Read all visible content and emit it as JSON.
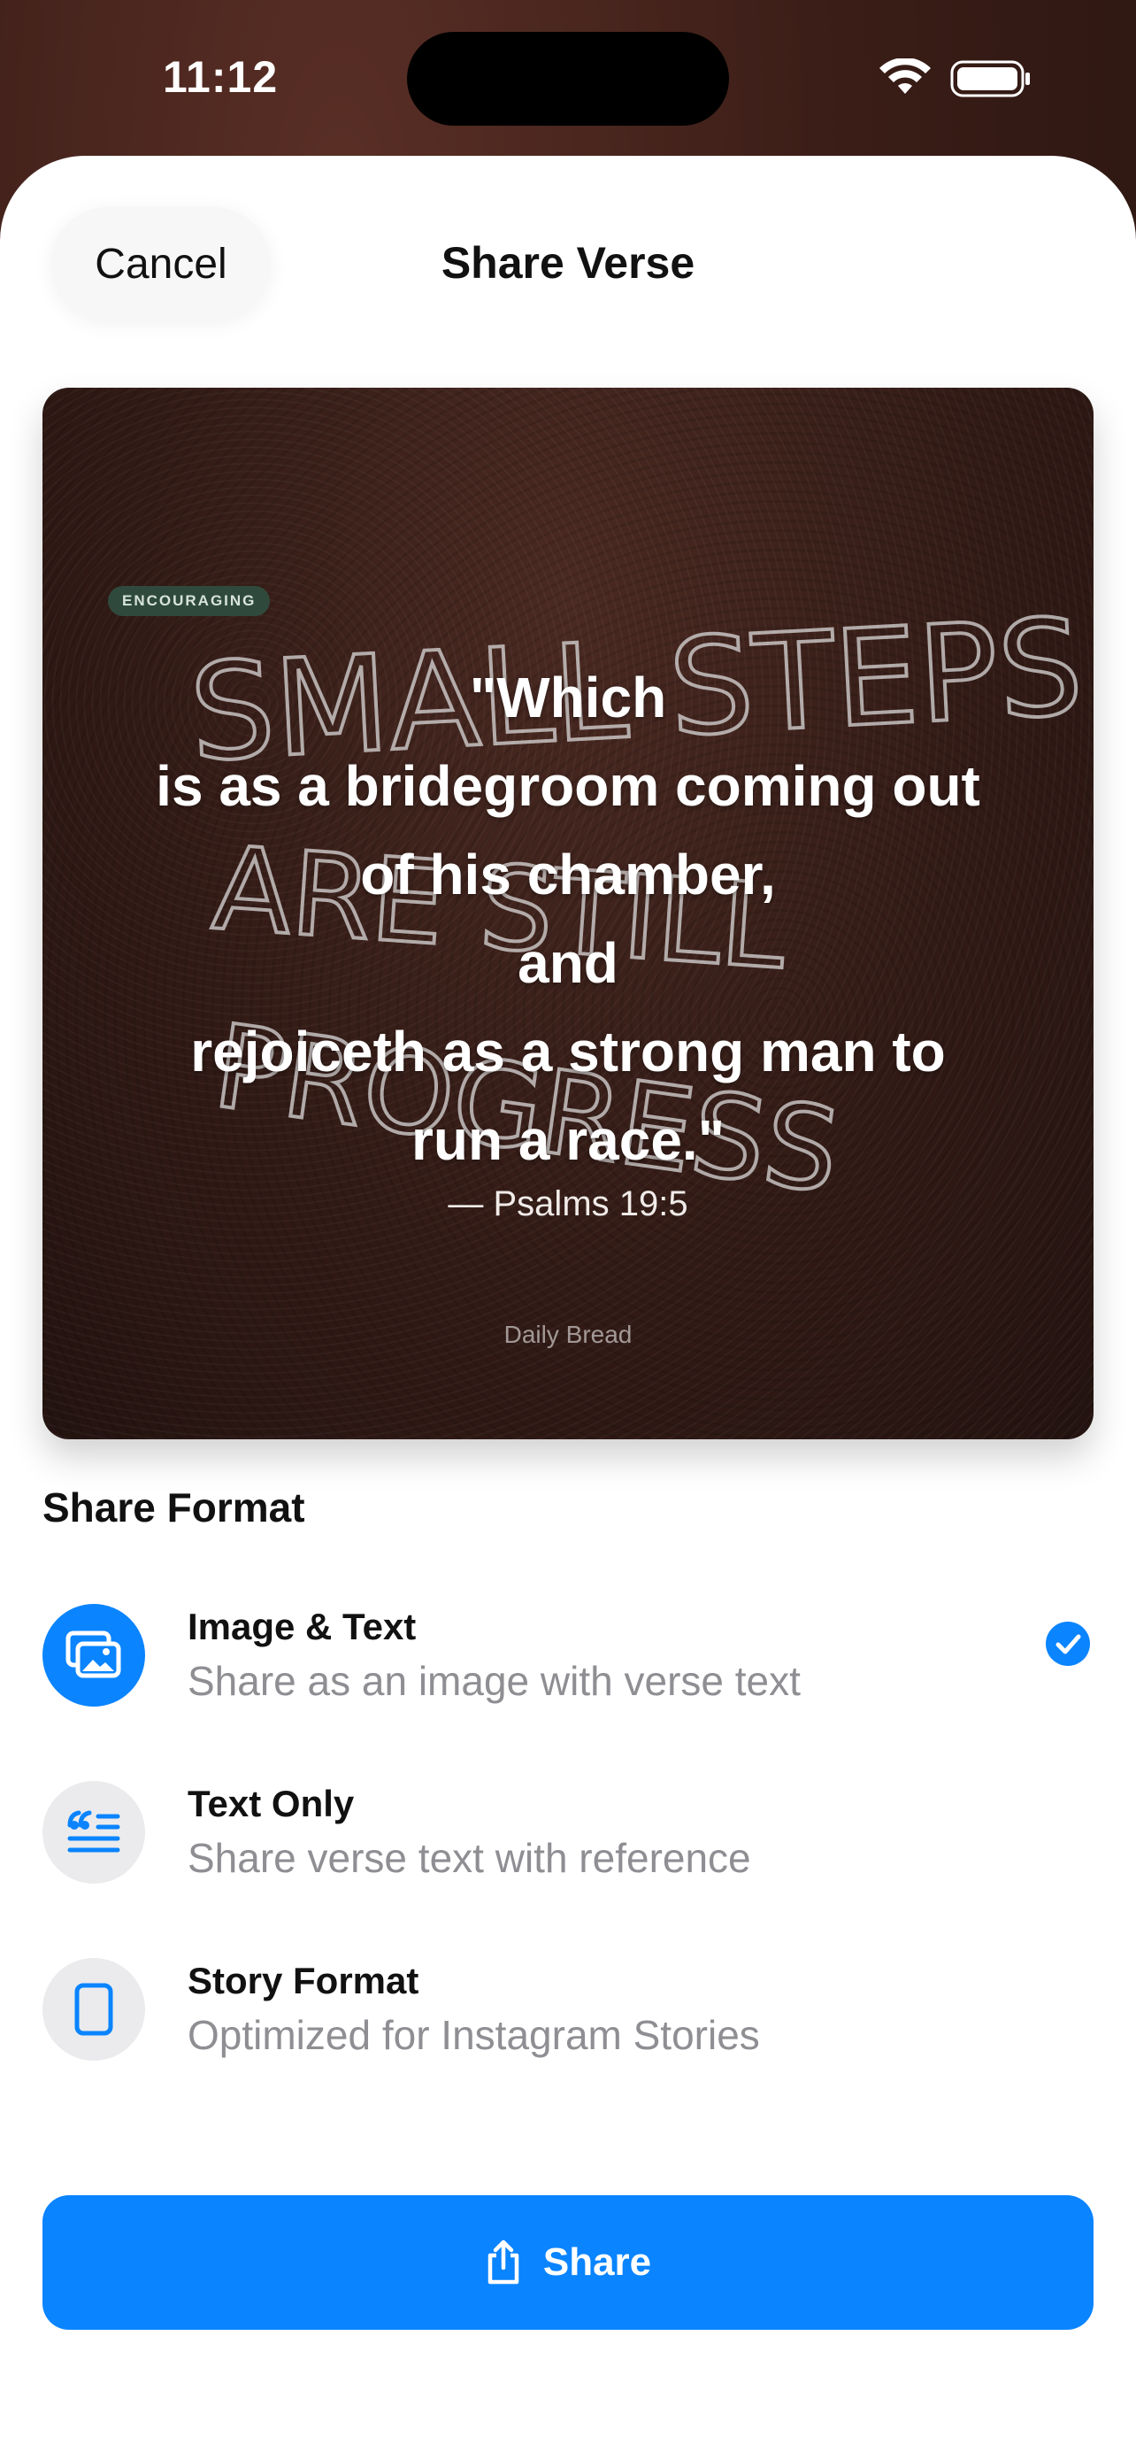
{
  "status_bar": {
    "time": "11:12"
  },
  "sheet": {
    "cancel_label": "Cancel",
    "title": "Share Verse"
  },
  "card": {
    "mood_tag": "ENCOURAGING",
    "verse": "\"Which\nis as a bridegroom coming out\nof his chamber,\nand\nrejoiceth as a strong man to\nrun a race.\"",
    "reference": "— Psalms 19:5",
    "watermark": "Daily Bread",
    "background_art_text": [
      "SMALL STEPS",
      "ARE STILL",
      "PROGRESS"
    ]
  },
  "share_format": {
    "section_title": "Share Format",
    "options": [
      {
        "label": "Image & Text",
        "description": "Share as an image with verse text",
        "icon": "photo-stack-icon",
        "selected": true
      },
      {
        "label": "Text Only",
        "description": "Share verse text with reference",
        "icon": "quote-text-icon",
        "selected": false
      },
      {
        "label": "Story Format",
        "description": "Optimized for Instagram Stories",
        "icon": "phone-rectangle-icon",
        "selected": false
      }
    ]
  },
  "share_button": {
    "label": "Share",
    "icon": "share-up-icon"
  },
  "colors": {
    "accent": "#0a84ff",
    "badge": "#2f4a3d",
    "card_background": "#331b16"
  }
}
